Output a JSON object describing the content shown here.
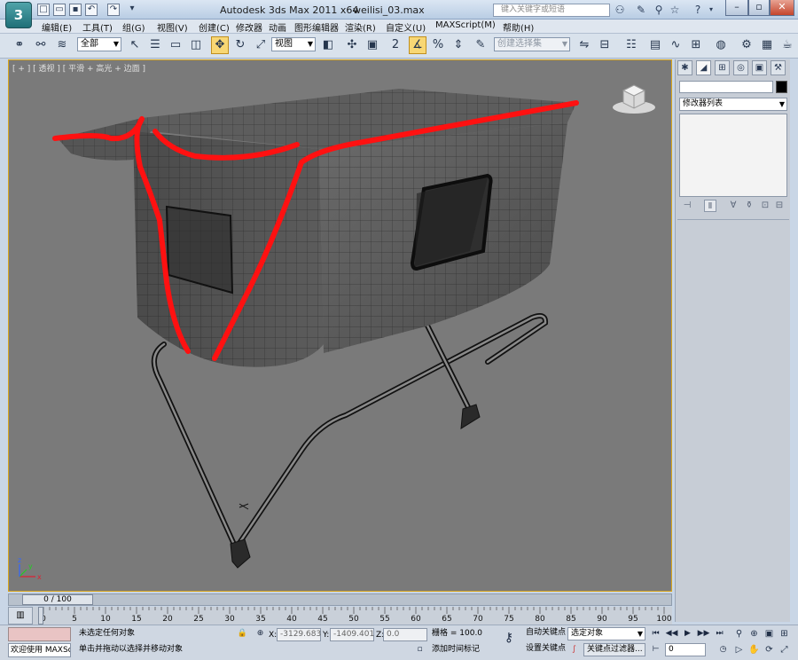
{
  "titlebar": {
    "app_name": "Autodesk 3ds Max  2011 x64",
    "file_name": "weilisi_03.max",
    "search_placeholder": "键入关键字或短语",
    "logo_letter": "3"
  },
  "menu": [
    "编辑(E)",
    "工具(T)",
    "组(G)",
    "视图(V)",
    "创建(C)",
    "修改器",
    "动画",
    "图形编辑器",
    "渲染(R)",
    "自定义(U)",
    "MAXScript(M)",
    "帮助(H)"
  ],
  "toolbar": {
    "selection_filter": "全部",
    "reference_coord": "视图",
    "named_selection": "创建选择集",
    "snap_number": "2"
  },
  "viewport": {
    "label": "[ + ] [ 透视 ] [ 平滑 + 高光 + 边面 ]",
    "axis_x": "x",
    "axis_y": "y",
    "axis_z": "z"
  },
  "command_panel": {
    "modifier_list": "修改器列表"
  },
  "time": {
    "slider_label": "0 / 100",
    "ticks": [
      "0",
      "5",
      "10",
      "15",
      "20",
      "25",
      "30",
      "35",
      "40",
      "45",
      "50",
      "55",
      "60",
      "65",
      "70",
      "75",
      "80",
      "85",
      "90",
      "95",
      "100"
    ]
  },
  "status": {
    "listener_text": "欢迎使用 MAXScri",
    "selection_status": "未选定任何对象",
    "prompt": "单击并拖动以选择并移动对象",
    "x_label": "X:",
    "x_value": "-3129.683",
    "y_label": "Y:",
    "y_value": "-1409.401",
    "z_label": "Z:",
    "z_value": "0.0",
    "grid": "栅格 = 100.0",
    "add_time_tag": "添加时间标记",
    "auto_key": "自动关键点",
    "selected_object": "选定对象",
    "set_key": "设置关键点",
    "key_filters": "关键点过滤器...",
    "frame_value": "0"
  }
}
